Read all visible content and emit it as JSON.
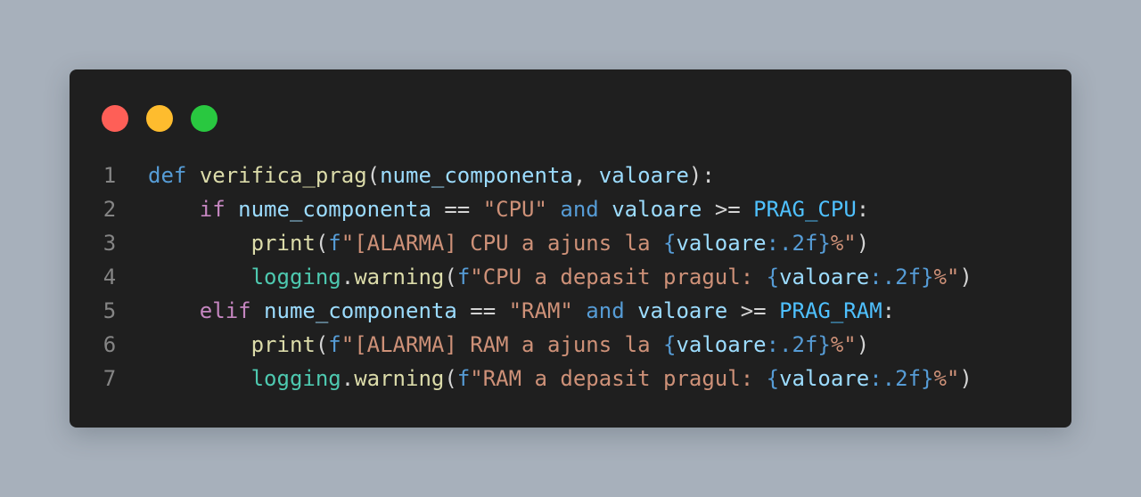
{
  "window": {
    "controls": [
      "close",
      "minimize",
      "maximize"
    ]
  },
  "code": {
    "language": "python",
    "lines": [
      {
        "number": "1",
        "indent": "",
        "tokens": [
          {
            "t": "def",
            "k": "kw"
          },
          {
            "t": " ",
            "k": "pun"
          },
          {
            "t": "verifica_prag",
            "k": "fn"
          },
          {
            "t": "(",
            "k": "pun"
          },
          {
            "t": "nume_componenta",
            "k": "par"
          },
          {
            "t": ", ",
            "k": "pun"
          },
          {
            "t": "valoare",
            "k": "par"
          },
          {
            "t": "):",
            "k": "pun"
          }
        ]
      },
      {
        "number": "2",
        "indent": "    ",
        "tokens": [
          {
            "t": "if",
            "k": "ctl"
          },
          {
            "t": " ",
            "k": "pun"
          },
          {
            "t": "nume_componenta",
            "k": "par"
          },
          {
            "t": " == ",
            "k": "pun"
          },
          {
            "t": "\"CPU\"",
            "k": "str"
          },
          {
            "t": " ",
            "k": "pun"
          },
          {
            "t": "and",
            "k": "kw"
          },
          {
            "t": " ",
            "k": "pun"
          },
          {
            "t": "valoare",
            "k": "par"
          },
          {
            "t": " >= ",
            "k": "pun"
          },
          {
            "t": "PRAG_CPU",
            "k": "cst"
          },
          {
            "t": ":",
            "k": "pun"
          }
        ]
      },
      {
        "number": "3",
        "indent": "        ",
        "tokens": [
          {
            "t": "print",
            "k": "fn"
          },
          {
            "t": "(",
            "k": "pun"
          },
          {
            "t": "f",
            "k": "kw"
          },
          {
            "t": "\"[ALARMA] CPU a ajuns la ",
            "k": "str"
          },
          {
            "t": "{",
            "k": "kw"
          },
          {
            "t": "valoare",
            "k": "par"
          },
          {
            "t": ":.2f}",
            "k": "kw"
          },
          {
            "t": "%\"",
            "k": "str"
          },
          {
            "t": ")",
            "k": "pun"
          }
        ]
      },
      {
        "number": "4",
        "indent": "        ",
        "tokens": [
          {
            "t": "logging",
            "k": "cls"
          },
          {
            "t": ".",
            "k": "pun"
          },
          {
            "t": "warning",
            "k": "fn"
          },
          {
            "t": "(",
            "k": "pun"
          },
          {
            "t": "f",
            "k": "kw"
          },
          {
            "t": "\"CPU a depasit pragul: ",
            "k": "str"
          },
          {
            "t": "{",
            "k": "kw"
          },
          {
            "t": "valoare",
            "k": "par"
          },
          {
            "t": ":.2f}",
            "k": "kw"
          },
          {
            "t": "%\"",
            "k": "str"
          },
          {
            "t": ")",
            "k": "pun"
          }
        ]
      },
      {
        "number": "5",
        "indent": "    ",
        "tokens": [
          {
            "t": "elif",
            "k": "ctl"
          },
          {
            "t": " ",
            "k": "pun"
          },
          {
            "t": "nume_componenta",
            "k": "par"
          },
          {
            "t": " == ",
            "k": "pun"
          },
          {
            "t": "\"RAM\"",
            "k": "str"
          },
          {
            "t": " ",
            "k": "pun"
          },
          {
            "t": "and",
            "k": "kw"
          },
          {
            "t": " ",
            "k": "pun"
          },
          {
            "t": "valoare",
            "k": "par"
          },
          {
            "t": " >= ",
            "k": "pun"
          },
          {
            "t": "PRAG_RAM",
            "k": "cst"
          },
          {
            "t": ":",
            "k": "pun"
          }
        ]
      },
      {
        "number": "6",
        "indent": "        ",
        "tokens": [
          {
            "t": "print",
            "k": "fn"
          },
          {
            "t": "(",
            "k": "pun"
          },
          {
            "t": "f",
            "k": "kw"
          },
          {
            "t": "\"[ALARMA] RAM a ajuns la ",
            "k": "str"
          },
          {
            "t": "{",
            "k": "kw"
          },
          {
            "t": "valoare",
            "k": "par"
          },
          {
            "t": ":.2f}",
            "k": "kw"
          },
          {
            "t": "%\"",
            "k": "str"
          },
          {
            "t": ")",
            "k": "pun"
          }
        ]
      },
      {
        "number": "7",
        "indent": "        ",
        "tokens": [
          {
            "t": "logging",
            "k": "cls"
          },
          {
            "t": ".",
            "k": "pun"
          },
          {
            "t": "warning",
            "k": "fn"
          },
          {
            "t": "(",
            "k": "pun"
          },
          {
            "t": "f",
            "k": "kw"
          },
          {
            "t": "\"RAM a depasit pragul: ",
            "k": "str"
          },
          {
            "t": "{",
            "k": "kw"
          },
          {
            "t": "valoare",
            "k": "par"
          },
          {
            "t": ":.2f}",
            "k": "kw"
          },
          {
            "t": "%\"",
            "k": "str"
          },
          {
            "t": ")",
            "k": "pun"
          }
        ]
      }
    ]
  },
  "colors": {
    "background": "#a7b0bb",
    "editor": "#1f1f1f",
    "dot_red": "#fe5f57",
    "dot_yellow": "#febc2e",
    "dot_green": "#29c840"
  }
}
